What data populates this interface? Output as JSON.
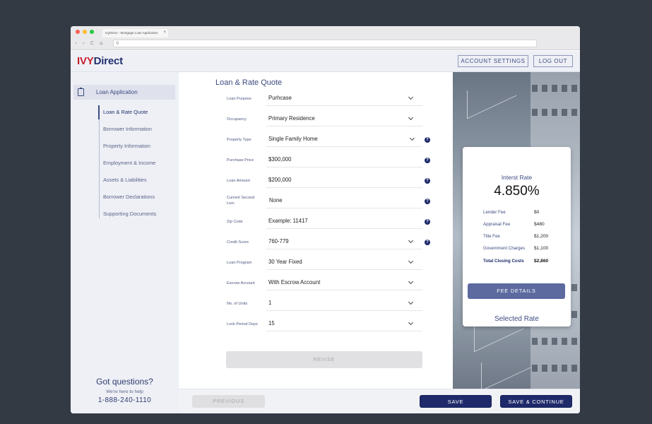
{
  "browser": {
    "tab_title": "IvyDirect - Mortgage Loan Application",
    "tab_close": "×",
    "nav_glyphs": "‹ › C ⌂",
    "search_glyph": "⚲"
  },
  "header": {
    "logo_ivy": "IVY",
    "logo_direct": "Direct",
    "account_settings": "ACCOUNT SETTINGS",
    "log_out": "LOG OUT"
  },
  "sidebar": {
    "main_item": "Loan Application",
    "steps": [
      "Loan & Rate Quote",
      "Borrower Information",
      "Property Information",
      "Employment & Income",
      "Assets & Liabilities",
      "Borrower Declarations",
      "Supporting Documents"
    ],
    "questions_title": "Got questions?",
    "questions_sub": "We're here to help",
    "phone": "1-888-240-1110"
  },
  "form": {
    "title": "Loan & Rate Quote",
    "fields": [
      {
        "label": "Loan Purpose",
        "value": "Purhcase"
      },
      {
        "label": "Occupancy",
        "value": "Primary Residence"
      },
      {
        "label": "Property Type",
        "value": "Single Family Home"
      },
      {
        "label": "Purchase Price",
        "value": "$300,000"
      },
      {
        "label": "Loan Amount",
        "value": "$200,000"
      },
      {
        "label": "Current Second Lien",
        "value": "None"
      },
      {
        "label": "Zip Code",
        "value": "Example: 11417"
      },
      {
        "label": "Credit Score",
        "value": "760-779"
      },
      {
        "label": "Loan Program",
        "value": "30 Year Fixed"
      },
      {
        "label": "Escrow Account",
        "value": "With Escrow Account"
      },
      {
        "label": "No. of Units",
        "value": "1"
      },
      {
        "label": "Lock Period Days",
        "value": "15"
      }
    ],
    "help_glyph": "?",
    "revise": "REVISE"
  },
  "footer": {
    "previous": "PREVIOUS",
    "save": "SAVE",
    "save_continue": "SAVE & CONTINUE"
  },
  "rate_card": {
    "label": "Interst Rate",
    "value": "4.850%",
    "fees": [
      {
        "name": "Lender Fee",
        "value": "$0"
      },
      {
        "name": "Appraisal Fee",
        "value": "$480"
      },
      {
        "name": "Title Fee",
        "value": "$1,200"
      },
      {
        "name": "Government Charges",
        "value": "$1,100"
      },
      {
        "name": "Total Closing Costs",
        "value": "$2,860"
      }
    ],
    "fee_details": "FEE DETAILS",
    "selected_rate": "Selected Rate"
  },
  "colors": {
    "brand_red": "#c8202f",
    "brand_navy": "#1e2a6a",
    "accent": "#3d4a80",
    "background": "#343a44"
  }
}
